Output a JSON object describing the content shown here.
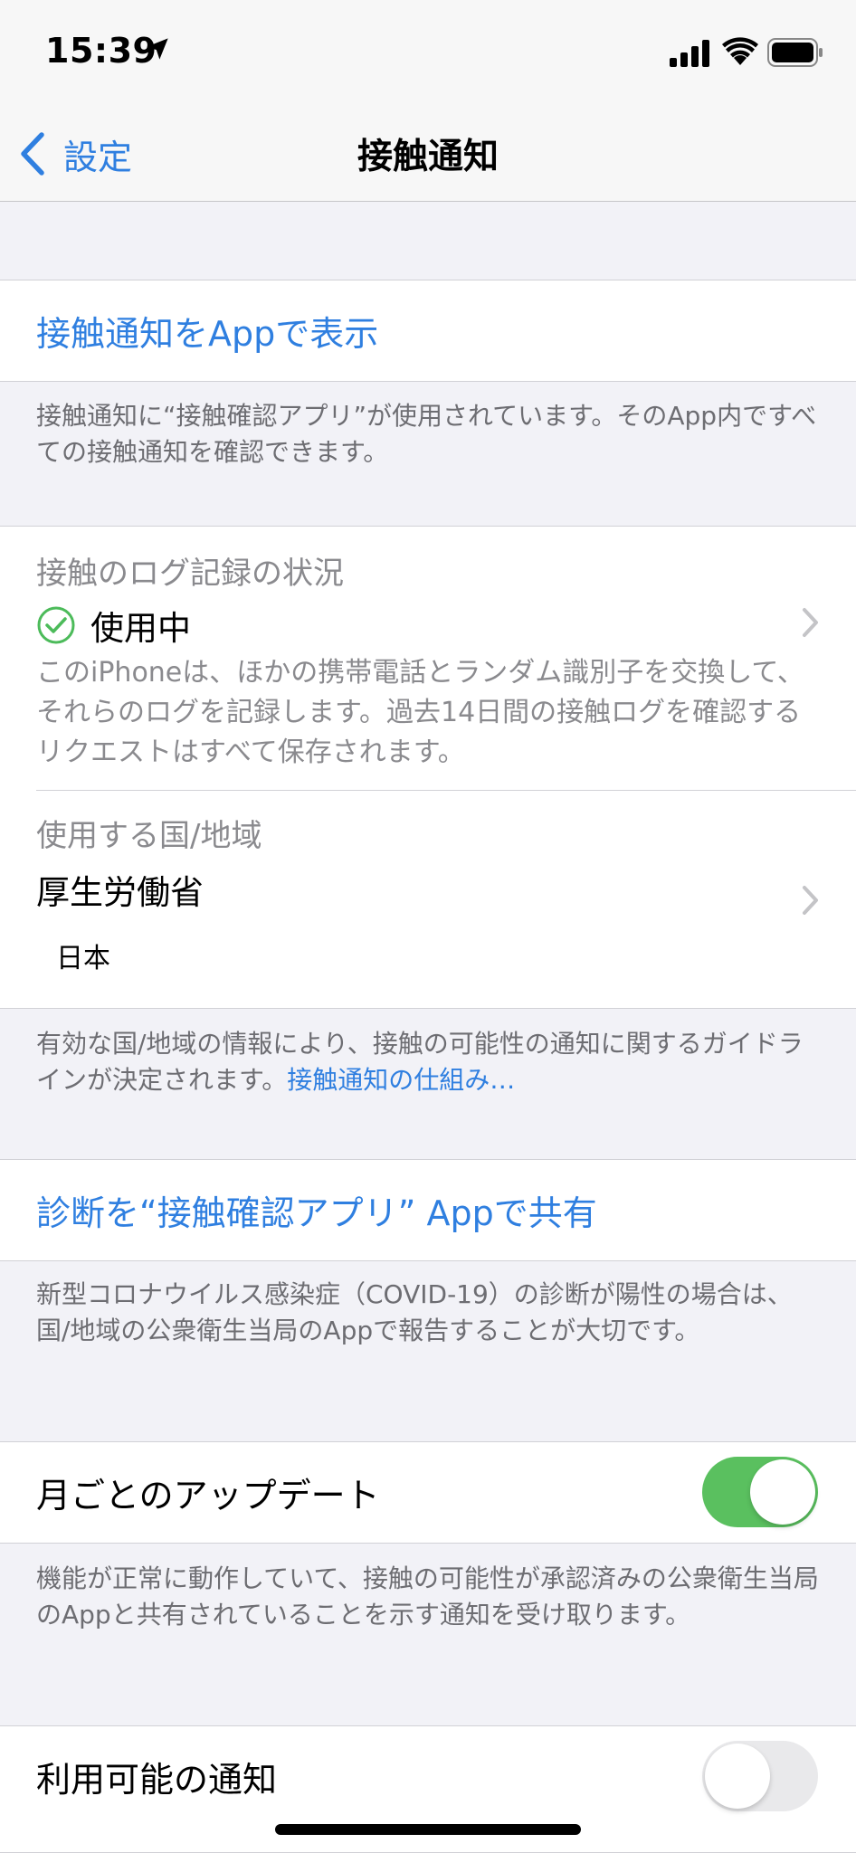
{
  "status_bar": {
    "time": "15:39"
  },
  "nav": {
    "back_label": "設定",
    "title": "接触通知"
  },
  "open_in_app": {
    "label": "接触通知をAppで表示",
    "footer": "接触通知に“接触確認アプリ”が使用されています。そのApp内ですべての接触通知を確認できます。"
  },
  "logging": {
    "header": "接触のログ記録の状況",
    "status": "使用中",
    "description": "このiPhoneは、ほかの携帯電話とランダム識別子を交換して、それらのログを記録します。過去14日間の接触ログを確認するリクエストはすべて保存されます。"
  },
  "region": {
    "header": "使用する国/地域",
    "authority": "厚生労働省",
    "country": "日本",
    "footer_text": "有効な国/地域の情報により、接触の可能性の通知に関するガイドラインが決定されます。",
    "footer_link": "接触通知の仕組み…"
  },
  "share_diagnosis": {
    "label": "診断を“接触確認アプリ” Appで共有",
    "footer": "新型コロナウイルス感染症（COVID-19）の診断が陽性の場合は、国/地域の公衆衛生当局のAppで報告することが大切です。"
  },
  "monthly_updates": {
    "label": "月ごとのアップデート",
    "enabled": true,
    "footer": "機能が正常に動作していて、接触の可能性が承認済みの公衆衛生当局のAppと共有されていることを示す通知を受け取ります。"
  },
  "availability_alerts": {
    "label": "利用可能の通知",
    "enabled": false
  },
  "colors": {
    "accent": "#2f7fe0",
    "toggle_on": "#5ac05f",
    "check": "#4cbb5a"
  }
}
